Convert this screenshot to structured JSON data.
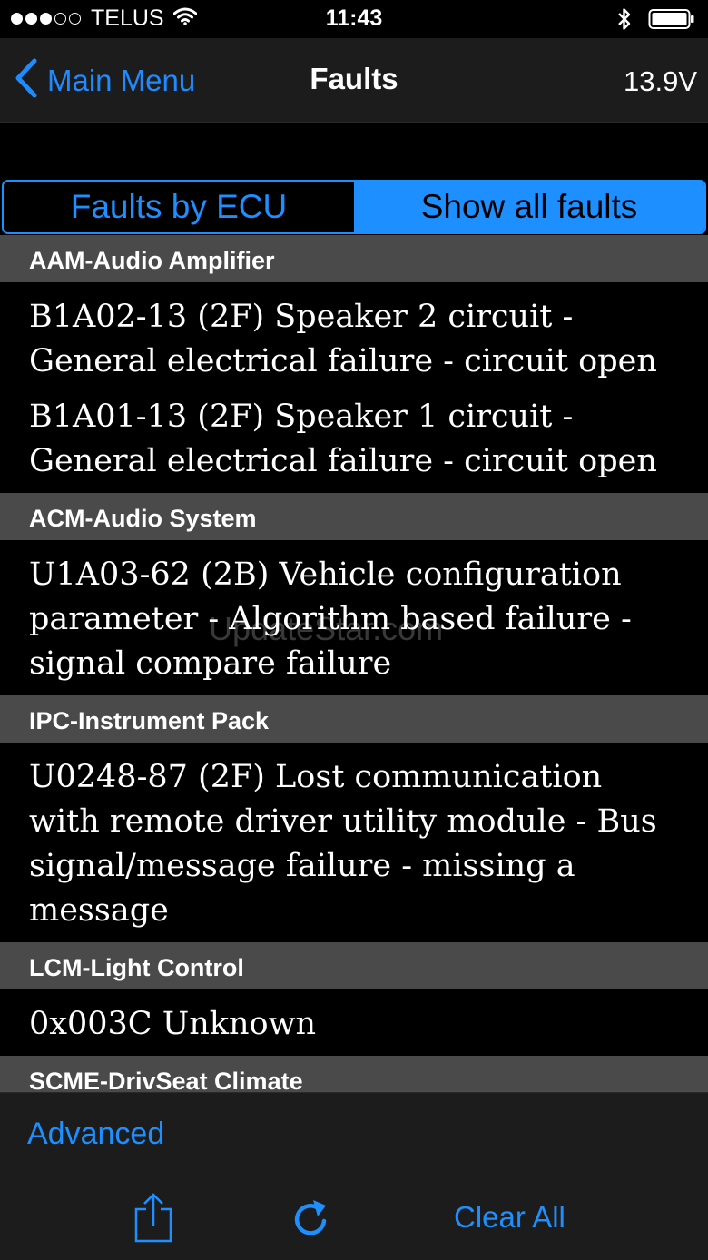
{
  "status_bar": {
    "carrier": "TELUS",
    "time": "11:43",
    "signal_filled": 3,
    "signal_total": 5
  },
  "nav": {
    "back_label": "Main Menu",
    "title": "Faults",
    "voltage": "13.9V"
  },
  "segments": {
    "left_label": "Faults by ECU",
    "right_label": "Show all faults",
    "selected": "right"
  },
  "sections": [
    {
      "header": "AAM-Audio Amplifier",
      "faults": [
        "B1A02-13 (2F) Speaker 2 circuit - General electrical failure - circuit open",
        "B1A01-13 (2F) Speaker 1 circuit - General electrical failure - circuit open"
      ]
    },
    {
      "header": "ACM-Audio System",
      "faults": [
        "U1A03-62 (2B) Vehicle configuration parameter - Algorithm based failure - signal compare failure"
      ]
    },
    {
      "header": "IPC-Instrument Pack",
      "faults": [
        "U0248-87 (2F) Lost communication with remote driver utility module - Bus signal/message failure - missing a message"
      ]
    },
    {
      "header": "LCM-Light Control",
      "faults": [
        "0x003C Unknown"
      ]
    },
    {
      "header": "SCME-DrivSeat Climate",
      "faults": []
    }
  ],
  "watermark": "UpdateStar.com",
  "advanced_label": "Advanced",
  "toolbar": {
    "clear_all_label": "Clear All"
  },
  "colors": {
    "accent": "#1e8fff",
    "section_header_bg": "#4a4a4a",
    "bar_bg": "#1c1c1c"
  }
}
